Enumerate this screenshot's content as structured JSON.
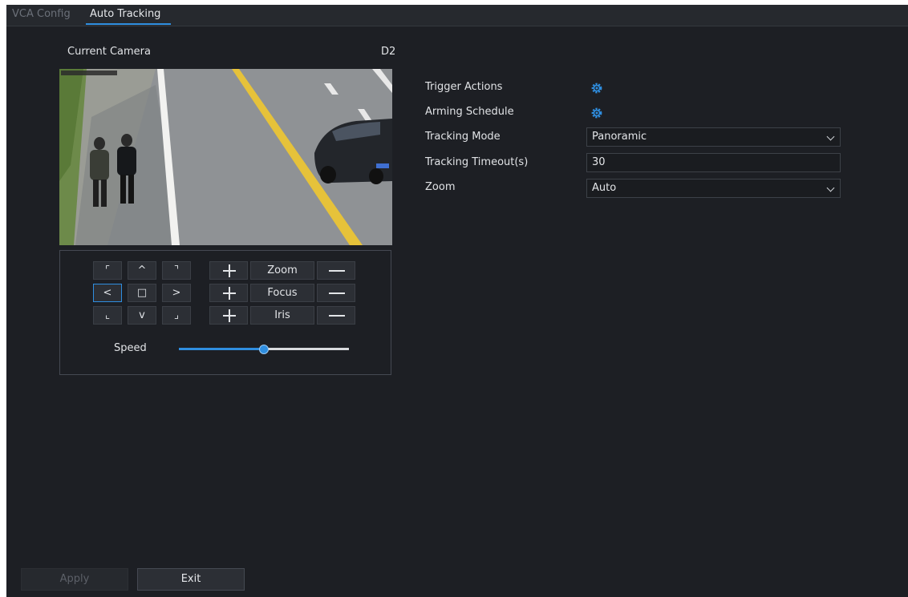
{
  "tabs": [
    {
      "label": "VCA Config",
      "active": false
    },
    {
      "label": "Auto Tracking",
      "active": true
    }
  ],
  "camera": {
    "label": "Current Camera",
    "value": "D2"
  },
  "ptz": {
    "directions": {
      "up_left": "⌜",
      "up": "^",
      "up_right": "⌝",
      "left": "<",
      "center": "□",
      "right": ">",
      "down_left": "⌞",
      "down": "v",
      "down_right": "⌟"
    },
    "zoom_label": "Zoom",
    "focus_label": "Focus",
    "iris_label": "Iris",
    "speed_label": "Speed",
    "speed_level": 0.5
  },
  "settings": {
    "trigger_actions_label": "Trigger Actions",
    "arming_schedule_label": "Arming Schedule",
    "tracking_mode_label": "Tracking Mode",
    "tracking_mode_value": "Panoramic",
    "tracking_timeout_label": "Tracking Timeout(s)",
    "tracking_timeout_value": "30",
    "zoom_label": "Zoom",
    "zoom_value": "Auto"
  },
  "footer": {
    "apply_label": "Apply",
    "exit_label": "Exit"
  },
  "colors": {
    "accent": "#2f8ee0",
    "background": "#1d1f24"
  }
}
